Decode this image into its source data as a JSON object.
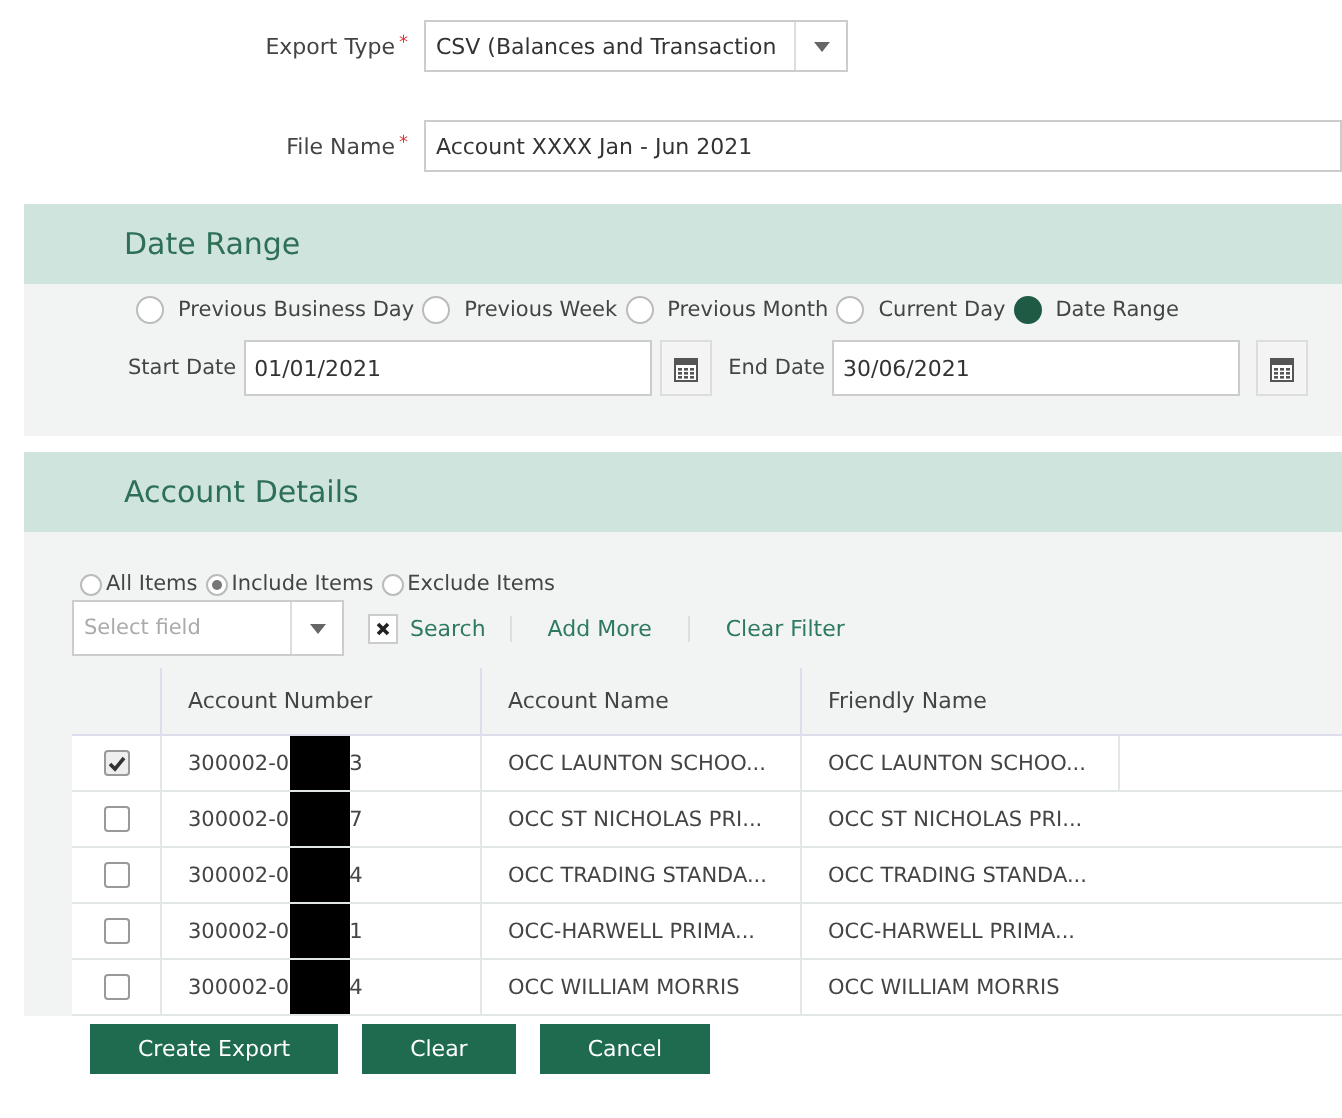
{
  "export_form": {
    "export_type": {
      "label": "Export Type",
      "required_mark": "*",
      "value": "CSV (Balances and Transaction"
    },
    "file_name": {
      "label": "File Name",
      "required_mark": "*",
      "value": "Account XXXX Jan - Jun 2021"
    }
  },
  "date_range": {
    "title": "Date Range",
    "options": [
      {
        "label": "Previous Business Day",
        "selected": false
      },
      {
        "label": "Previous Week",
        "selected": false
      },
      {
        "label": "Previous Month",
        "selected": false
      },
      {
        "label": "Current Day",
        "selected": false
      },
      {
        "label": "Date Range",
        "selected": true
      }
    ],
    "start_date": {
      "label": "Start Date",
      "value": "01/01/2021"
    },
    "end_date": {
      "label": "End Date",
      "value": "30/06/2021"
    }
  },
  "account_details": {
    "title": "Account Details",
    "filter_options": [
      {
        "label": "All Items",
        "selected": false
      },
      {
        "label": "Include Items",
        "selected": true
      },
      {
        "label": "Exclude Items",
        "selected": false
      }
    ],
    "field_select": {
      "placeholder": "Select field"
    },
    "actions": [
      "Search",
      "Add More",
      "Clear Filter"
    ],
    "table": {
      "columns": [
        "Account Number",
        "Account Name",
        "Friendly Name"
      ],
      "rows": [
        {
          "checked": true,
          "number_start": "300002-0",
          "number_end": "3",
          "account_name": "OCC LAUNTON SCHOO...",
          "friendly_name": "OCC LAUNTON SCHOO..."
        },
        {
          "checked": false,
          "number_start": "300002-0",
          "number_end": "7",
          "account_name": "OCC ST NICHOLAS PRI...",
          "friendly_name": "OCC ST NICHOLAS PRI..."
        },
        {
          "checked": false,
          "number_start": "300002-0",
          "number_end": "4",
          "account_name": "OCC TRADING STANDA...",
          "friendly_name": "OCC TRADING STANDA..."
        },
        {
          "checked": false,
          "number_start": "300002-0",
          "number_end": "1",
          "account_name": "OCC-HARWELL PRIMA...",
          "friendly_name": "OCC-HARWELL PRIMA..."
        },
        {
          "checked": false,
          "number_start": "300002-0",
          "number_end": "4",
          "account_name": "OCC WILLIAM MORRIS",
          "friendly_name": "OCC WILLIAM MORRIS"
        }
      ]
    }
  },
  "buttons": [
    "Create Export",
    "Clear",
    "Cancel"
  ]
}
